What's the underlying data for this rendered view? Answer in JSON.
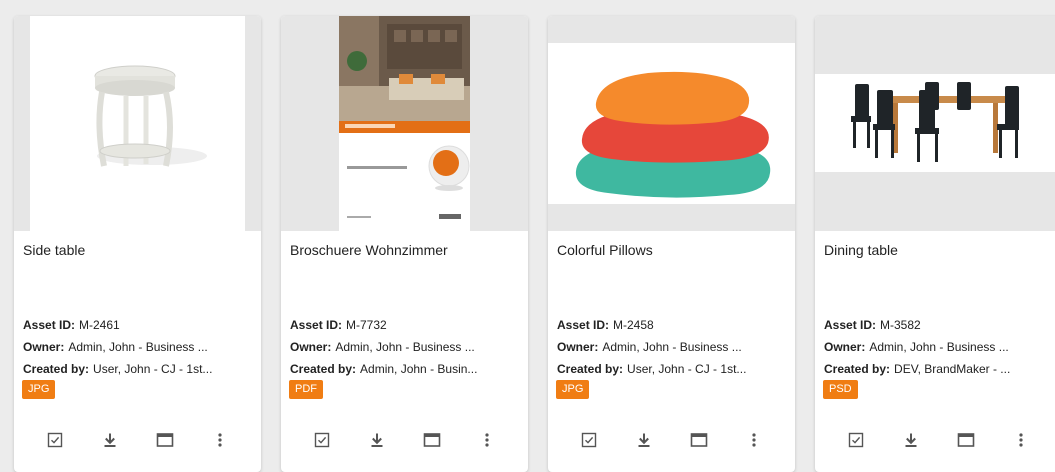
{
  "labels": {
    "asset_id": "Asset ID:",
    "owner": "Owner:",
    "created_by": "Created by:"
  },
  "cards": [
    {
      "title": "Side table",
      "asset_id": "M-2461",
      "owner": "Admin, John - Business ...",
      "created_by": "User, John - CJ - 1st...",
      "format": "JPG"
    },
    {
      "title": "Broschuere Wohnzimmer",
      "asset_id": "M-7732",
      "owner": "Admin, John - Business ...",
      "created_by": "Admin, John - Busin...",
      "format": "PDF"
    },
    {
      "title": "Colorful Pillows",
      "asset_id": "M-2458",
      "owner": "Admin, John - Business ...",
      "created_by": "User, John - CJ - 1st...",
      "format": "JPG"
    },
    {
      "title": "Dining table",
      "asset_id": "M-3582",
      "owner": "Admin, John - Business ...",
      "created_by": "DEV, BrandMaker - ...",
      "format": "PSD"
    }
  ],
  "icons": {
    "select": "checkbox-icon",
    "download": "download-icon",
    "preview": "window-icon",
    "more": "more-vert-icon"
  },
  "colors": {
    "badge": "#f07d13",
    "card_bg": "#ffffff",
    "thumb_bg": "#e6e6e6"
  }
}
